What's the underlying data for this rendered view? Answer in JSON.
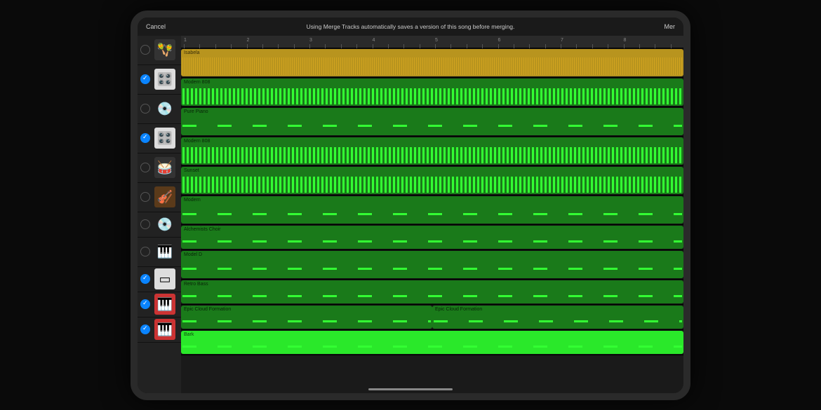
{
  "topbar": {
    "cancel": "Cancel",
    "message": "Using Merge Tracks automatically saves a version of this song before merging.",
    "action": "Mer"
  },
  "ruler": {
    "marks": [
      "1",
      "2",
      "3",
      "4",
      "5",
      "6",
      "7",
      "8"
    ]
  },
  "tracks": [
    {
      "checked": false,
      "icon": "shaker",
      "iconBg": "#333",
      "regionName": "Isabela",
      "regionColor": "yellow",
      "clipType": "audio",
      "h": "lg"
    },
    {
      "checked": true,
      "icon": "drum-machine",
      "iconBg": "#ddd",
      "regionName": "Modern 808",
      "regionColor": "green",
      "clipType": "dense",
      "h": "lg"
    },
    {
      "checked": false,
      "icon": "synth-round",
      "iconBg": "#222",
      "regionName": "Pure Piano",
      "regionColor": "green",
      "clipType": "sparse",
      "h": "lg"
    },
    {
      "checked": true,
      "icon": "drum-machine",
      "iconBg": "#ddd",
      "regionName": "Modern 808",
      "regionColor": "green",
      "clipType": "dense",
      "h": "lg"
    },
    {
      "checked": false,
      "icon": "drumkit",
      "iconBg": "#333",
      "regionName": "Sunset",
      "regionColor": "green",
      "clipType": "dense",
      "h": "lg"
    },
    {
      "checked": false,
      "icon": "strings",
      "iconBg": "#5a3a1a",
      "regionName": "Modern",
      "regionColor": "green",
      "clipType": "sparse",
      "h": "lg"
    },
    {
      "checked": false,
      "icon": "synth-round",
      "iconBg": "#222",
      "regionName": "Alchemists Choir",
      "regionColor": "green",
      "clipType": "sparse",
      "h": "sm"
    },
    {
      "checked": false,
      "icon": "keyboard",
      "iconBg": "#222",
      "regionName": "Model D",
      "regionColor": "green",
      "clipType": "sparse",
      "h": "lg"
    },
    {
      "checked": true,
      "icon": "synth-module",
      "iconBg": "#ddd",
      "regionName": "Retro Bass",
      "regionColor": "green",
      "clipType": "sparse",
      "h": "sm"
    },
    {
      "checked": true,
      "icon": "red-keys",
      "iconBg": "#c33",
      "regionName": "Epic Cloud Formation",
      "regionName2": "Epic Cloud Formation",
      "regionColor": "green",
      "clipType": "sparse",
      "split": true,
      "h": "sm"
    },
    {
      "checked": true,
      "icon": "red-keys",
      "iconBg": "#c33",
      "regionName": "Bark",
      "regionColor": "bright",
      "clipType": "sparse",
      "h": "sm"
    }
  ]
}
